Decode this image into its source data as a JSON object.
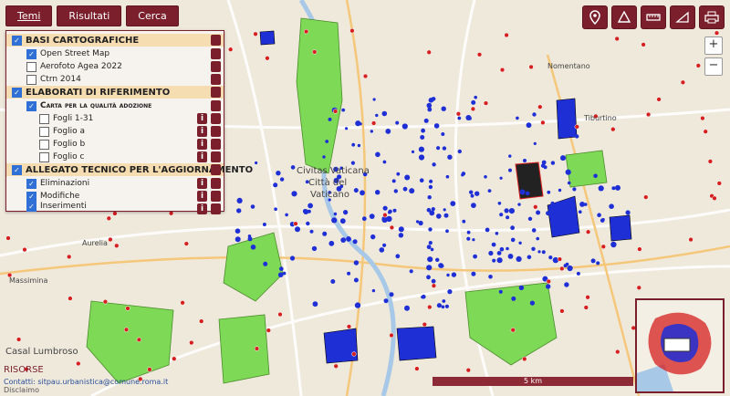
{
  "tabs": [
    {
      "label": "Temi",
      "active": true
    },
    {
      "label": "Risultati",
      "active": false
    },
    {
      "label": "Cerca",
      "active": false
    }
  ],
  "toolbar": {
    "icons": [
      "location-pin-icon",
      "recycle-icon",
      "measure-ruler-icon",
      "area-ruler-icon",
      "print-icon"
    ]
  },
  "zoom": {
    "in_label": "+",
    "out_label": "−"
  },
  "layers": {
    "basi_title": "BASI CARTOGRAFICHE",
    "basi_items": [
      {
        "label": "Open Street Map",
        "checked": true
      },
      {
        "label": "Aerofoto Agea 2022",
        "checked": false
      },
      {
        "label": "Ctrn 2014",
        "checked": false
      }
    ],
    "elaborati_title": "ELABORATI DI RIFERIMENTO",
    "carta_label": "Carta per la qualità adozione",
    "fogli": [
      {
        "label": "Fogli 1-31",
        "checked": false
      },
      {
        "label": "Foglio a",
        "checked": false
      },
      {
        "label": "Foglio b",
        "checked": false
      },
      {
        "label": "Foglio c",
        "checked": false
      }
    ],
    "allegato_title": "ALLEGATO TECNICO PER L'AGGIORNAMENTO",
    "allegato_items": [
      {
        "label": "Eliminazioni",
        "checked": true
      },
      {
        "label": "Modifiche",
        "checked": true
      },
      {
        "label": "Inserimenti",
        "checked": true
      }
    ],
    "info_glyph": "i"
  },
  "map_labels": {
    "vatican": "Civitas Vaticana",
    "vatican2": "Città del",
    "vatican3": "Vaticano",
    "casal": "Casal Lumbroso",
    "aurelia": "Aurelia",
    "massimina": "Massimina",
    "nomentano": "Nomentano",
    "tiburtino": "Tiburtino"
  },
  "scale_label": "5 km",
  "footer": {
    "brand": "RISORSE",
    "contact": "Contatti: sitpau.urbanistica@comune.roma.it",
    "disclaimer": "Disclaimo"
  },
  "colors": {
    "accent": "#7a1f2b",
    "green_area": "#7ed957",
    "blue_point": "#1f2fd6",
    "red_point": "#d61f1f"
  }
}
